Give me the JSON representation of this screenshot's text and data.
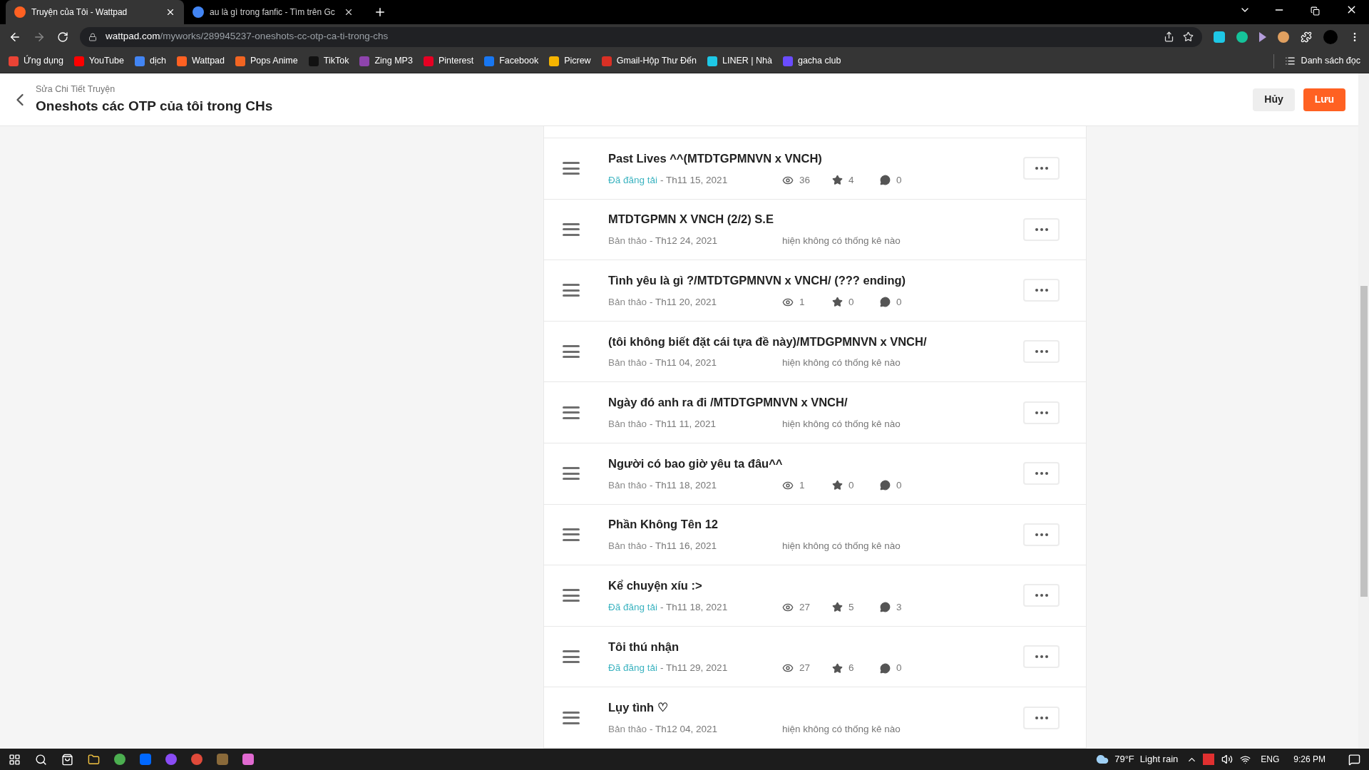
{
  "browser": {
    "tabs": [
      {
        "title": "Truyện của Tôi - Wattpad",
        "selected": true,
        "color": "#ff6122"
      },
      {
        "title": "au là gì trong fanfic - Tìm trên Gc",
        "selected": false,
        "color": "#4285f4"
      }
    ],
    "url": {
      "host": "wattpad.com",
      "path": "/myworks/289945237-oneshots-cc-otp-ca-ti-trong-chs"
    },
    "bookmarks": [
      {
        "label": "Ứng dụng",
        "color": "#ea4335"
      },
      {
        "label": "YouTube",
        "color": "#ff0000"
      },
      {
        "label": "dịch",
        "color": "#4285f4"
      },
      {
        "label": "Wattpad",
        "color": "#ff6122"
      },
      {
        "label": "Pops Anime",
        "color": "#f26522"
      },
      {
        "label": "TikTok",
        "color": "#111111"
      },
      {
        "label": "Zing MP3",
        "color": "#8e44ad"
      },
      {
        "label": "Pinterest",
        "color": "#e60023"
      },
      {
        "label": "Facebook",
        "color": "#1877f2"
      },
      {
        "label": "Picrew",
        "color": "#f5b400"
      },
      {
        "label": "Gmail-Hộp Thư Đến",
        "color": "#d93025"
      },
      {
        "label": "LINER | Nhà",
        "color": "#1ec8e6"
      },
      {
        "label": "gacha club",
        "color": "#6a4cff"
      }
    ],
    "reading_list": "Danh sách đọc"
  },
  "header": {
    "breadcrumb": "Sửa Chi Tiết Truyện",
    "title": "Oneshots các OTP của tôi trong CHs",
    "buttons": [
      {
        "label": "Hủy",
        "kind": "secondary"
      },
      {
        "label": "Lưu",
        "kind": "primary"
      }
    ]
  },
  "parts": [
    {
      "title": "Past Lives ^^(MTDTGPMNVN x VNCH)",
      "status": {
        "label": "Đã đăng tải",
        "kind": "published"
      },
      "date": "- Th11 15, 2021",
      "stats": {
        "views": "36",
        "votes": "4",
        "comments": "0"
      }
    },
    {
      "title": "MTDTGPMN X VNCH (2/2) S.E",
      "status": {
        "label": "Bản thảo",
        "kind": "draft"
      },
      "date": "- Th12 24, 2021",
      "no_stats": "hiện không có thống kê nào"
    },
    {
      "title": "Tình yêu là gì ?/MTDTGPMNVN x VNCH/ (??? ending)",
      "status": {
        "label": "Bản thảo",
        "kind": "draft"
      },
      "date": "- Th11 20, 2021",
      "stats": {
        "views": "1",
        "votes": "0",
        "comments": "0"
      }
    },
    {
      "title": "(tôi không biết đặt cái tựa đề này)/MTDGPMNVN x VNCH/",
      "status": {
        "label": "Bản thảo",
        "kind": "draft"
      },
      "date": "- Th11 04, 2021",
      "no_stats": "hiện không có thống kê nào"
    },
    {
      "title": "Ngày đó anh ra đi /MTDTGPMNVN x VNCH/",
      "status": {
        "label": "Bản thảo",
        "kind": "draft"
      },
      "date": "- Th11 11, 2021",
      "no_stats": "hiện không có thống kê nào"
    },
    {
      "title": "Người có bao giờ yêu ta đâu^^",
      "status": {
        "label": "Bản thảo",
        "kind": "draft"
      },
      "date": "- Th11 18, 2021",
      "stats": {
        "views": "1",
        "votes": "0",
        "comments": "0"
      }
    },
    {
      "title": "Phần Không Tên 12",
      "status": {
        "label": "Bản thảo",
        "kind": "draft"
      },
      "date": "- Th11 16, 2021",
      "no_stats": "hiện không có thống kê nào"
    },
    {
      "title": "Kể chuyện xíu :>",
      "status": {
        "label": "Đã đăng tải",
        "kind": "published"
      },
      "date": "- Th11 18, 2021",
      "stats": {
        "views": "27",
        "votes": "5",
        "comments": "3"
      }
    },
    {
      "title": "Tôi thú nhận",
      "status": {
        "label": "Đã đăng tải",
        "kind": "published"
      },
      "date": "- Th11 29, 2021",
      "stats": {
        "views": "27",
        "votes": "6",
        "comments": "0"
      }
    },
    {
      "title": "Lụy tình ♡",
      "status": {
        "label": "Bản thảo",
        "kind": "draft"
      },
      "date": "- Th12 04, 2021",
      "no_stats": "hiện không có thống kê nào"
    }
  ],
  "taskbar": {
    "temperature": "79°F",
    "weather": "Light rain",
    "language": "ENG",
    "time": "9:26 PM"
  }
}
